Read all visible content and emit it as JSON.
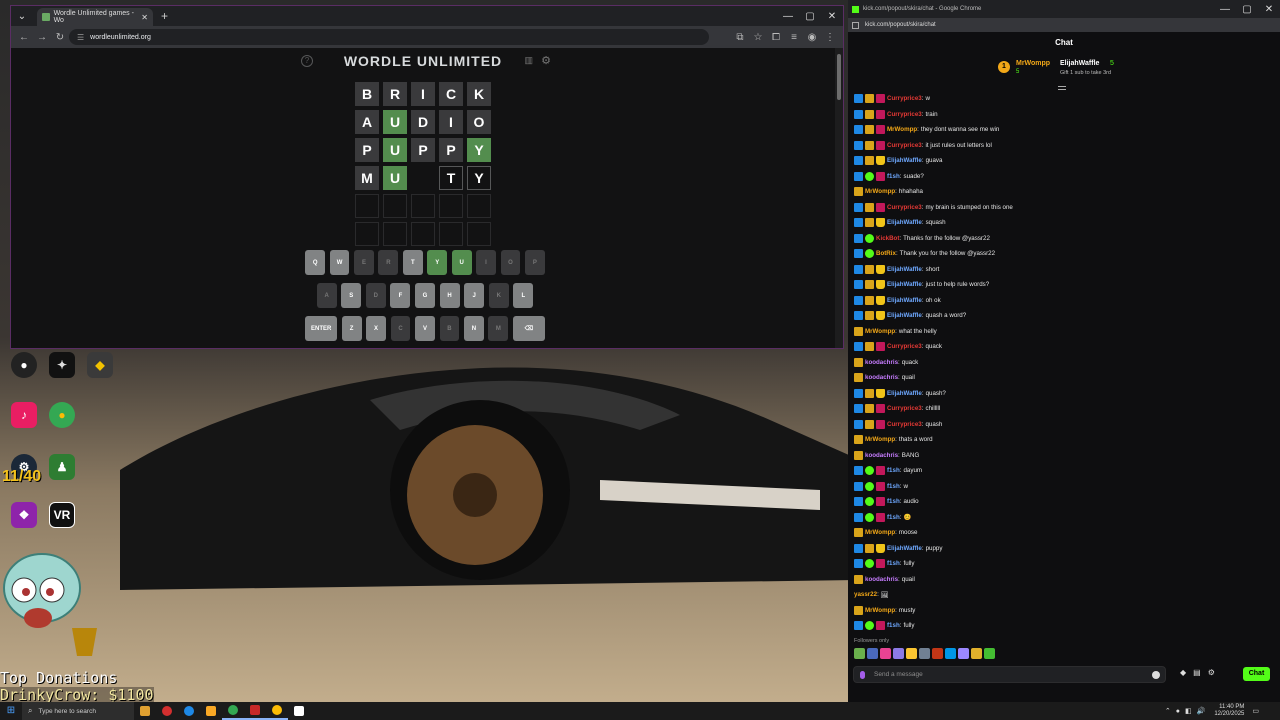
{
  "browser": {
    "tab_title": "Wordle Unlimited games - Wo",
    "url": "wordleunlimited.org"
  },
  "wordle": {
    "title": "WORDLE UNLIMITED",
    "grid": [
      [
        {
          "l": "B",
          "s": "absent"
        },
        {
          "l": "R",
          "s": "absent"
        },
        {
          "l": "I",
          "s": "absent"
        },
        {
          "l": "C",
          "s": "absent"
        },
        {
          "l": "K",
          "s": "absent"
        }
      ],
      [
        {
          "l": "A",
          "s": "absent"
        },
        {
          "l": "U",
          "s": "correct"
        },
        {
          "l": "D",
          "s": "absent"
        },
        {
          "l": "I",
          "s": "absent"
        },
        {
          "l": "O",
          "s": "absent"
        }
      ],
      [
        {
          "l": "P",
          "s": "absent"
        },
        {
          "l": "U",
          "s": "correct"
        },
        {
          "l": "P",
          "s": "absent"
        },
        {
          "l": "P",
          "s": "absent"
        },
        {
          "l": "Y",
          "s": "correct"
        }
      ],
      [
        {
          "l": "M",
          "s": "absent"
        },
        {
          "l": "U",
          "s": "correct"
        },
        {
          "l": "",
          "s": "gap"
        },
        {
          "l": "T",
          "s": "typed"
        },
        {
          "l": "Y",
          "s": "typed"
        }
      ],
      [
        {
          "l": "",
          "s": "empty"
        },
        {
          "l": "",
          "s": "empty"
        },
        {
          "l": "",
          "s": "empty"
        },
        {
          "l": "",
          "s": "empty"
        },
        {
          "l": "",
          "s": "empty"
        }
      ],
      [
        {
          "l": "",
          "s": "empty"
        },
        {
          "l": "",
          "s": "empty"
        },
        {
          "l": "",
          "s": "empty"
        },
        {
          "l": "",
          "s": "empty"
        },
        {
          "l": "",
          "s": "empty"
        }
      ]
    ],
    "keyboard": [
      [
        {
          "k": "Q",
          "s": "normal"
        },
        {
          "k": "W",
          "s": "normal"
        },
        {
          "k": "E",
          "s": "absent"
        },
        {
          "k": "R",
          "s": "absent"
        },
        {
          "k": "T",
          "s": "normal"
        },
        {
          "k": "Y",
          "s": "correct"
        },
        {
          "k": "U",
          "s": "correct"
        },
        {
          "k": "I",
          "s": "absent"
        },
        {
          "k": "O",
          "s": "absent"
        },
        {
          "k": "P",
          "s": "absent"
        }
      ],
      [
        {
          "k": "A",
          "s": "absent"
        },
        {
          "k": "S",
          "s": "normal"
        },
        {
          "k": "D",
          "s": "absent"
        },
        {
          "k": "F",
          "s": "normal"
        },
        {
          "k": "G",
          "s": "normal"
        },
        {
          "k": "H",
          "s": "normal"
        },
        {
          "k": "J",
          "s": "normal"
        },
        {
          "k": "K",
          "s": "absent"
        },
        {
          "k": "L",
          "s": "normal"
        }
      ],
      [
        {
          "k": "ENTER",
          "s": "normal",
          "wide": true
        },
        {
          "k": "Z",
          "s": "normal"
        },
        {
          "k": "X",
          "s": "normal"
        },
        {
          "k": "C",
          "s": "absent"
        },
        {
          "k": "V",
          "s": "normal"
        },
        {
          "k": "B",
          "s": "absent"
        },
        {
          "k": "N",
          "s": "normal"
        },
        {
          "k": "M",
          "s": "absent"
        },
        {
          "k": "⌫",
          "s": "normal",
          "wide": true
        }
      ]
    ]
  },
  "desktop": {
    "counter": "11/40",
    "donations_label": "Top Donations",
    "donations_value": "DrinkyCrow: $1100",
    "vr_label": "VR"
  },
  "chat": {
    "window_title": "kick.com/popout/skira/chat - Google Chrome",
    "url": "kick.com/popout/skira/chat",
    "header": "Chat",
    "gift": {
      "badge": "1",
      "from": "MrWompp",
      "from_amount": "5",
      "to": "ElijahWaffle",
      "to_amount": "5",
      "note": "Gift 1 sub to take 3rd"
    },
    "messages": [
      {
        "badges": [
          "blue",
          "gold",
          "gift"
        ],
        "user": "Curryprice3",
        "color": "#e53935",
        "text": "w"
      },
      {
        "badges": [
          "blue",
          "gold",
          "gift"
        ],
        "user": "Curryprice3",
        "color": "#e53935",
        "text": "train"
      },
      {
        "badges": [
          "blue",
          "gold",
          "gift"
        ],
        "user": "MrWompp",
        "color": "#f3a818",
        "text": "they dont wanna see me win"
      },
      {
        "badges": [
          "blue",
          "gold",
          "gift"
        ],
        "user": "Curryprice3",
        "color": "#e53935",
        "text": "it just rules out letters lol"
      },
      {
        "badges": [
          "blue",
          "gold",
          "crown"
        ],
        "user": "ElijahWaffle",
        "color": "#6ea8ff",
        "text": "guava"
      },
      {
        "badges": [
          "blue",
          "mod",
          "gift"
        ],
        "user": "f1sh",
        "color": "#6ea8ff",
        "text": "suade?"
      },
      {
        "badges": [
          "gold"
        ],
        "user": "MrWompp",
        "color": "#f3a818",
        "text": "hhahaha"
      },
      {
        "badges": [
          "blue",
          "gold",
          "gift"
        ],
        "user": "Curryprice3",
        "color": "#e53935",
        "text": "my brain is stumped on this one"
      },
      {
        "badges": [
          "blue",
          "gold",
          "crown"
        ],
        "user": "ElijahWaffle",
        "color": "#6ea8ff",
        "text": "squash"
      },
      {
        "badges": [
          "blue",
          "mod"
        ],
        "user": "KickBot",
        "color": "#e53935",
        "text": "Thanks for the follow @yassr22"
      },
      {
        "badges": [
          "blue",
          "mod"
        ],
        "user": "BotRix",
        "color": "#f3a818",
        "text": "Thank you for the follow @yassr22"
      },
      {
        "badges": [
          "blue",
          "gold",
          "crown"
        ],
        "user": "ElijahWaffle",
        "color": "#6ea8ff",
        "text": "short"
      },
      {
        "badges": [
          "blue",
          "gold",
          "crown"
        ],
        "user": "ElijahWaffle",
        "color": "#6ea8ff",
        "text": "just to help rule words?"
      },
      {
        "badges": [
          "blue",
          "gold",
          "crown"
        ],
        "user": "ElijahWaffle",
        "color": "#6ea8ff",
        "text": "oh ok"
      },
      {
        "badges": [
          "blue",
          "gold",
          "crown"
        ],
        "user": "ElijahWaffle",
        "color": "#6ea8ff",
        "text": "quash a word?"
      },
      {
        "badges": [
          "gold"
        ],
        "user": "MrWompp",
        "color": "#f3a818",
        "text": "what the helly"
      },
      {
        "badges": [
          "blue",
          "gold",
          "gift"
        ],
        "user": "Curryprice3",
        "color": "#e53935",
        "text": "quack"
      },
      {
        "badges": [
          "gold"
        ],
        "user": "koodachris",
        "color": "#c77dff",
        "text": "quack"
      },
      {
        "badges": [
          "gold"
        ],
        "user": "koodachris",
        "color": "#c77dff",
        "text": "quail"
      },
      {
        "badges": [
          "blue",
          "gold",
          "crown"
        ],
        "user": "ElijahWaffle",
        "color": "#6ea8ff",
        "text": "quash?"
      },
      {
        "badges": [
          "blue",
          "gold",
          "gift"
        ],
        "user": "Curryprice3",
        "color": "#e53935",
        "text": "chilllll"
      },
      {
        "badges": [
          "blue",
          "gold",
          "gift"
        ],
        "user": "Curryprice3",
        "color": "#e53935",
        "text": "quash"
      },
      {
        "badges": [
          "gold"
        ],
        "user": "MrWompp",
        "color": "#f3a818",
        "text": "thats a word"
      },
      {
        "badges": [
          "gold"
        ],
        "user": "koodachris",
        "color": "#c77dff",
        "text": "BANG"
      },
      {
        "badges": [
          "blue",
          "mod",
          "gift"
        ],
        "user": "f1sh",
        "color": "#6ea8ff",
        "text": "dayum"
      },
      {
        "badges": [
          "blue",
          "mod",
          "gift"
        ],
        "user": "f1sh",
        "color": "#6ea8ff",
        "text": "w"
      },
      {
        "badges": [
          "blue",
          "mod",
          "gift"
        ],
        "user": "f1sh",
        "color": "#6ea8ff",
        "text": "audio"
      },
      {
        "badges": [
          "blue",
          "mod",
          "gift"
        ],
        "user": "f1sh",
        "color": "#6ea8ff",
        "text": "😊"
      },
      {
        "badges": [
          "gold"
        ],
        "user": "MrWompp",
        "color": "#f3a818",
        "text": "moose"
      },
      {
        "badges": [
          "blue",
          "gold",
          "crown"
        ],
        "user": "ElijahWaffle",
        "color": "#6ea8ff",
        "text": "puppy"
      },
      {
        "badges": [
          "blue",
          "mod",
          "gift"
        ],
        "user": "f1sh",
        "color": "#6ea8ff",
        "text": "fully"
      },
      {
        "badges": [
          "gold"
        ],
        "user": "koodachris",
        "color": "#c77dff",
        "text": "quail"
      },
      {
        "badges": [],
        "user": "yassr22",
        "color": "#f3a818",
        "text": "🖼"
      },
      {
        "badges": [
          "gold"
        ],
        "user": "MrWompp",
        "color": "#f3a818",
        "text": "musty"
      },
      {
        "badges": [
          "blue",
          "mod",
          "gift"
        ],
        "user": "f1sh",
        "color": "#6ea8ff",
        "text": "fully"
      }
    ],
    "followers_only": "Followers only",
    "input_placeholder": "Send a message",
    "send_label": "Chat"
  },
  "taskbar": {
    "search_placeholder": "Type here to search",
    "time": "11:40 PM",
    "date": "12/20/2025"
  }
}
